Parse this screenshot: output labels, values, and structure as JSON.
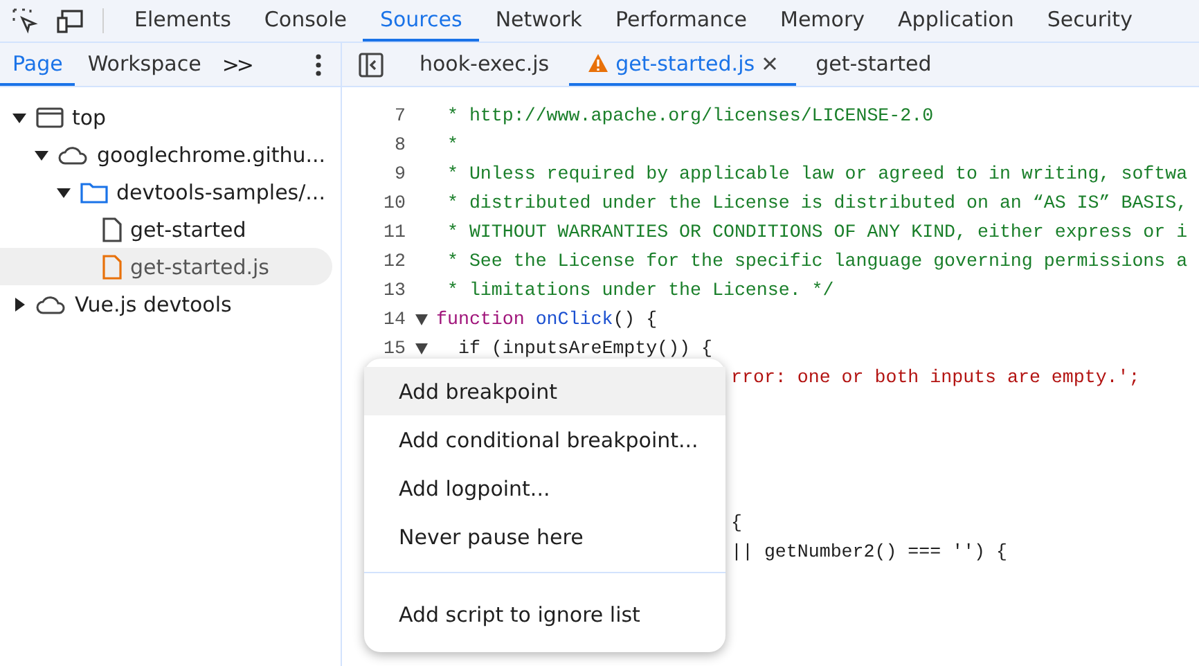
{
  "main_tabs": [
    {
      "label": "Elements",
      "selected": false
    },
    {
      "label": "Console",
      "selected": false
    },
    {
      "label": "Sources",
      "selected": true
    },
    {
      "label": "Network",
      "selected": false
    },
    {
      "label": "Performance",
      "selected": false
    },
    {
      "label": "Memory",
      "selected": false
    },
    {
      "label": "Application",
      "selected": false
    },
    {
      "label": "Security",
      "selected": false
    }
  ],
  "sidebar": {
    "tabs": [
      {
        "label": "Page",
        "selected": true
      },
      {
        "label": "Workspace",
        "selected": false
      }
    ],
    "more": ">>",
    "tree": [
      {
        "kind": "frame",
        "label": "top",
        "expanded": true,
        "children": [
          {
            "kind": "cloud",
            "label": "googlechrome.githu...",
            "expanded": true,
            "children": [
              {
                "kind": "folder",
                "label": "devtools-samples/...",
                "expanded": true,
                "children": [
                  {
                    "kind": "file",
                    "label": "get-started",
                    "selected": false
                  },
                  {
                    "kind": "jsfile",
                    "label": "get-started.js",
                    "selected": true
                  }
                ]
              }
            ]
          }
        ]
      },
      {
        "kind": "cloud",
        "label": "Vue.js devtools",
        "expanded": false
      }
    ]
  },
  "editor_tabs": [
    {
      "label": "hook-exec.js",
      "selected": false,
      "warning": false,
      "closable": false
    },
    {
      "label": "get-started.js",
      "selected": true,
      "warning": true,
      "closable": true
    },
    {
      "label": "get-started",
      "selected": false,
      "warning": false,
      "closable": false
    }
  ],
  "code": [
    {
      "number": "7",
      "kind": "comment",
      "text": " * http://www.apache.org/licenses/LICENSE-2.0",
      "fold": false
    },
    {
      "number": "8",
      "kind": "comment",
      "text": " *",
      "fold": false
    },
    {
      "number": "9",
      "kind": "comment",
      "text": " * Unless required by applicable law or agreed to in writing, softwa",
      "fold": false
    },
    {
      "number": "10",
      "kind": "comment",
      "text": " * distributed under the License is distributed on an “AS IS” BASIS,",
      "fold": false
    },
    {
      "number": "11",
      "kind": "comment",
      "text": " * WITHOUT WARRANTIES OR CONDITIONS OF ANY KIND, either express or i",
      "fold": false
    },
    {
      "number": "12",
      "kind": "comment",
      "text": " * See the License for the specific language governing permissions a",
      "fold": false
    },
    {
      "number": "13",
      "kind": "comment",
      "text": " * limitations under the License. */",
      "fold": false
    },
    {
      "number": "14",
      "kind": "function",
      "keyword": "function",
      "name": "onClick",
      "text": "() {",
      "fold": true
    },
    {
      "number": "15",
      "kind": "plain",
      "text": "  if (inputsAreEmpty()) {",
      "fold": true
    }
  ],
  "covered_code": [
    {
      "kind": "string",
      "text": "rror: one or both inputs are empty.';"
    },
    {
      "kind": "plain",
      "text": "{"
    },
    {
      "kind": "plain",
      "text": "|| getNumber2() === '') {"
    }
  ],
  "context_menu": {
    "groups": [
      [
        {
          "label": "Add breakpoint",
          "selected": true
        },
        {
          "label": "Add conditional breakpoint...",
          "selected": false
        },
        {
          "label": "Add logpoint...",
          "selected": false
        },
        {
          "label": "Never pause here",
          "selected": false
        }
      ],
      [
        {
          "label": "Add script to ignore list",
          "selected": false
        }
      ]
    ]
  }
}
